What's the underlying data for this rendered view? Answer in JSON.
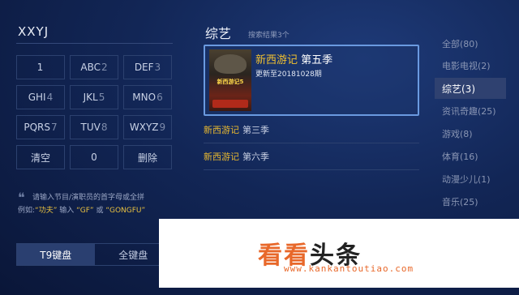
{
  "search": {
    "query": "XXYJ"
  },
  "keypad": {
    "keys": [
      {
        "main": "1",
        "num": ""
      },
      {
        "main": "ABC",
        "num": "2"
      },
      {
        "main": "DEF",
        "num": "3"
      },
      {
        "main": "GHI",
        "num": "4"
      },
      {
        "main": "JKL",
        "num": "5"
      },
      {
        "main": "MNO",
        "num": "6"
      },
      {
        "main": "PQRS",
        "num": "7"
      },
      {
        "main": "TUV",
        "num": "8"
      },
      {
        "main": "WXYZ",
        "num": "9"
      },
      {
        "main": "清空",
        "num": ""
      },
      {
        "main": "0",
        "num": ""
      },
      {
        "main": "删除",
        "num": ""
      }
    ]
  },
  "hint": {
    "quote_mark": "❝",
    "line1": "请输入节目/演职员的首字母或全拼",
    "line2_prefix": "例如:",
    "example_name": "“功夫”",
    "input_label": " 输入 ",
    "example_abbr": "“GF”",
    "or_label": " 或 ",
    "example_full": "“GONGFU”"
  },
  "keyboard_tabs": [
    {
      "label": "T9键盘",
      "active": true
    },
    {
      "label": "全键盘",
      "active": false
    }
  ],
  "results": {
    "category_title": "综艺",
    "count_text": "搜索结果3个",
    "featured": {
      "title_highlight": "新西游记",
      "title_rest": " 第五季",
      "subtitle": "更新至20181028期",
      "poster_text": "新西游记5"
    },
    "items": [
      {
        "highlight": "新西游记",
        "rest": "第三季"
      },
      {
        "highlight": "新西游记",
        "rest": "第六季"
      }
    ]
  },
  "filters": [
    {
      "label": "全部(80)",
      "active": false
    },
    {
      "label": "电影电视(2)",
      "active": false
    },
    {
      "label": "综艺(3)",
      "active": true
    },
    {
      "label": "资讯奇趣(25)",
      "active": false
    },
    {
      "label": "游戏(8)",
      "active": false
    },
    {
      "label": "体育(16)",
      "active": false
    },
    {
      "label": "动漫少儿(1)",
      "active": false
    },
    {
      "label": "音乐(25)",
      "active": false
    }
  ],
  "watermark": {
    "brand_part1": "看看",
    "brand_part2": "头条",
    "url": "www.kankantoutiao.com"
  },
  "colors": {
    "highlight": "#e8b830",
    "focus_border": "#6a9ae0",
    "active_filter_bg": "#2f4170",
    "brand_orange": "#e8682a"
  }
}
